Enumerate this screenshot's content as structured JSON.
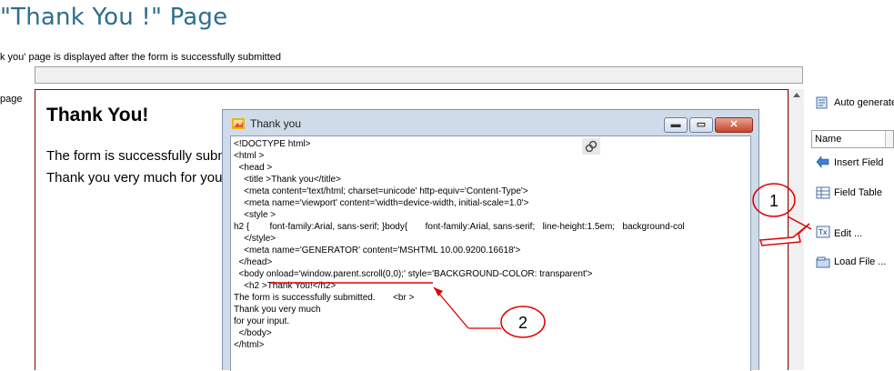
{
  "header": {
    "title": "\"Thank You !\" Page",
    "description": "k you' page is displayed after the form is successfully submitted",
    "page_label": "page"
  },
  "preview": {
    "heading": "Thank You!",
    "line1": "The form is successfully submi",
    "line2": "Thank you very much for your"
  },
  "dialog": {
    "title": "Thank you",
    "buttons": {
      "minimize": "▬",
      "maximize": "▭",
      "close": "✕"
    },
    "code_lines": [
      "<!DOCTYPE html>",
      "<html >",
      "  <head >",
      "    <title >Thank you</title>",
      "    <meta content='text/html; charset=unicode' http-equiv='Content-Type'>",
      "    <meta name='viewport' content='width=device-width, initial-scale=1.0'>",
      "    <style >",
      "h2 {        font-family:Arial, sans-serif; }body{       font-family:Arial, sans-serif;   line-height:1.5em;   background-col",
      "    </style>",
      "    <meta name='GENERATOR' content='MSHTML 10.00.9200.16618'>",
      "  </head>",
      "  <body onload='window.parent.scroll(0,0);' style='BACKGROUND-COLOR: transparent'>",
      "    <h2 >Thank You!</h2>",
      "The form is successfully submitted.       <br >",
      "Thank you very much",
      "for your input.",
      "  </body>",
      "</html>"
    ]
  },
  "sidebar": {
    "auto_generate": "Auto generate",
    "name_select": "Name",
    "insert_field": "Insert Field",
    "field_table": "Field Table",
    "edit": "Edit ...",
    "load_file": "Load File ..."
  },
  "annotations": {
    "callout_1": "1",
    "callout_2": "2",
    "color": "#e00000"
  }
}
